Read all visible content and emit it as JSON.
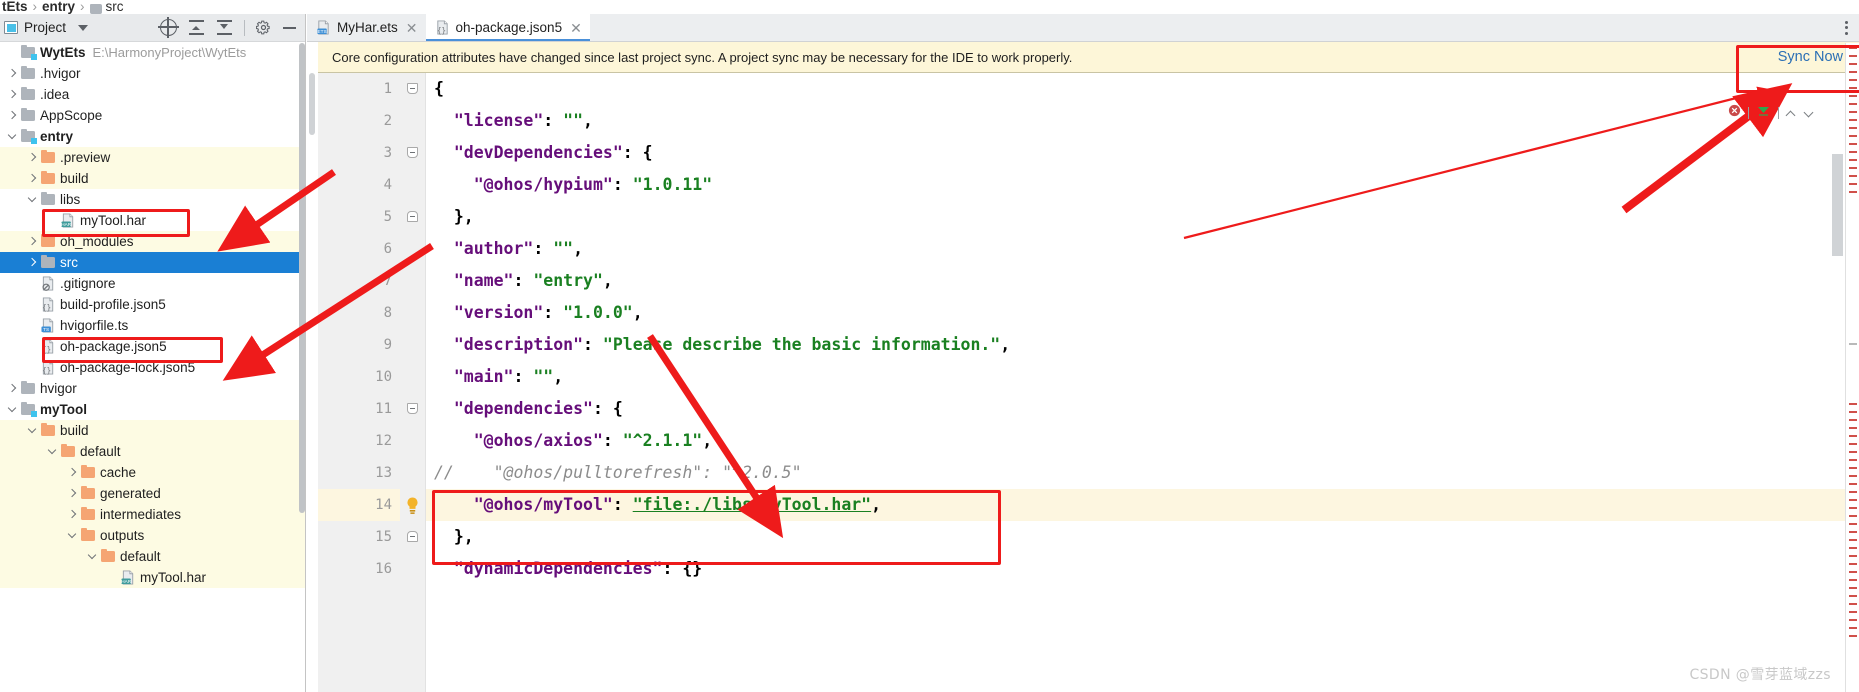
{
  "breadcrumb": {
    "items": [
      "tEts",
      "entry",
      "src"
    ]
  },
  "panel": {
    "title": "Project",
    "icons": [
      "project-icon",
      "chevron-down-icon",
      "locate-icon",
      "expand-all-icon",
      "collapse-all-icon",
      "gear-icon",
      "minimize-icon"
    ],
    "tree": [
      {
        "label": "WytEts",
        "path": "E:\\HarmonyProject\\WytEts",
        "indent": 0,
        "arrow": "none",
        "icon": "folder-module",
        "bold": true
      },
      {
        "label": ".hvigor",
        "path": "",
        "indent": 0,
        "arrow": "right",
        "icon": "folder-grey",
        "bold": false
      },
      {
        "label": ".idea",
        "path": "",
        "indent": 0,
        "arrow": "right",
        "icon": "folder-grey",
        "bold": false
      },
      {
        "label": "AppScope",
        "path": "",
        "indent": 0,
        "arrow": "right",
        "icon": "folder-grey",
        "bold": false
      },
      {
        "label": "entry",
        "path": "",
        "indent": 0,
        "arrow": "down",
        "icon": "folder-module",
        "bold": true
      },
      {
        "label": ".preview",
        "path": "",
        "indent": 1,
        "arrow": "right",
        "icon": "folder-orange",
        "bold": false,
        "highlight": "yellow"
      },
      {
        "label": "build",
        "path": "",
        "indent": 1,
        "arrow": "right",
        "icon": "folder-orange",
        "bold": false,
        "highlight": "yellow"
      },
      {
        "label": "libs",
        "path": "",
        "indent": 1,
        "arrow": "down",
        "icon": "folder-grey",
        "bold": false
      },
      {
        "label": "myTool.har",
        "path": "",
        "indent": 2,
        "arrow": "none",
        "icon": "file-har",
        "bold": false
      },
      {
        "label": "oh_modules",
        "path": "",
        "indent": 1,
        "arrow": "right",
        "icon": "folder-orange",
        "bold": false,
        "highlight": "yellow"
      },
      {
        "label": "src",
        "path": "",
        "indent": 1,
        "arrow": "right",
        "icon": "folder-grey",
        "bold": false,
        "selected": true
      },
      {
        "label": ".gitignore",
        "path": "",
        "indent": 1,
        "arrow": "none",
        "icon": "file-git",
        "bold": false
      },
      {
        "label": "build-profile.json5",
        "path": "",
        "indent": 1,
        "arrow": "none",
        "icon": "file-json",
        "bold": false
      },
      {
        "label": "hvigorfile.ts",
        "path": "",
        "indent": 1,
        "arrow": "none",
        "icon": "file-ts",
        "bold": false
      },
      {
        "label": "oh-package.json5",
        "path": "",
        "indent": 1,
        "arrow": "none",
        "icon": "file-json",
        "bold": false
      },
      {
        "label": "oh-package-lock.json5",
        "path": "",
        "indent": 1,
        "arrow": "none",
        "icon": "file-json",
        "bold": false
      },
      {
        "label": "hvigor",
        "path": "",
        "indent": 0,
        "arrow": "right",
        "icon": "folder-grey",
        "bold": false
      },
      {
        "label": "myTool",
        "path": "",
        "indent": 0,
        "arrow": "down",
        "icon": "folder-module",
        "bold": true
      },
      {
        "label": "build",
        "path": "",
        "indent": 1,
        "arrow": "down",
        "icon": "folder-orange",
        "bold": false,
        "highlight": "yellow"
      },
      {
        "label": "default",
        "path": "",
        "indent": 2,
        "arrow": "down",
        "icon": "folder-orange",
        "bold": false,
        "highlight": "yellow"
      },
      {
        "label": "cache",
        "path": "",
        "indent": 3,
        "arrow": "right",
        "icon": "folder-orange",
        "bold": false,
        "highlight": "yellow"
      },
      {
        "label": "generated",
        "path": "",
        "indent": 3,
        "arrow": "right",
        "icon": "folder-orange",
        "bold": false,
        "highlight": "yellow"
      },
      {
        "label": "intermediates",
        "path": "",
        "indent": 3,
        "arrow": "right",
        "icon": "folder-orange",
        "bold": false,
        "highlight": "yellow"
      },
      {
        "label": "outputs",
        "path": "",
        "indent": 3,
        "arrow": "down",
        "icon": "folder-orange",
        "bold": false,
        "highlight": "yellow"
      },
      {
        "label": "default",
        "path": "",
        "indent": 4,
        "arrow": "down",
        "icon": "folder-orange",
        "bold": false,
        "highlight": "yellow"
      },
      {
        "label": "myTool.har",
        "path": "",
        "indent": 5,
        "arrow": "none",
        "icon": "file-har",
        "bold": false,
        "highlight": "yellow"
      }
    ]
  },
  "editor": {
    "tabs": [
      {
        "label": "MyHar.ets",
        "icon": "ets-file-icon",
        "active": false
      },
      {
        "label": "oh-package.json5",
        "icon": "json-file-icon",
        "active": true
      }
    ],
    "tab_overflow_icon": "more-vertical-icon",
    "notification": {
      "text": "Core configuration attributes have changed since last project sync. A project sync may be necessary for the IDE to work properly.",
      "action": "Sync Now"
    },
    "inspection_widget": {
      "error_count_icon": "error-marker-icon",
      "ok_icon": "inspection-ok-icon",
      "prev_icon": "chevron-up-icon",
      "next_icon": "chevron-down-icon"
    },
    "lines": [
      {
        "n": "1",
        "fold": "open-start",
        "segments": [
          {
            "t": "{",
            "c": "punc"
          }
        ]
      },
      {
        "n": "2",
        "fold": "",
        "segments": [
          {
            "t": "  ",
            "c": "punc"
          },
          {
            "t": "\"license\"",
            "c": "key"
          },
          {
            "t": ": ",
            "c": "punc"
          },
          {
            "t": "\"\"",
            "c": "str"
          },
          {
            "t": ",",
            "c": "punc"
          }
        ]
      },
      {
        "n": "3",
        "fold": "open",
        "segments": [
          {
            "t": "  ",
            "c": "punc"
          },
          {
            "t": "\"devDependencies\"",
            "c": "key"
          },
          {
            "t": ": {",
            "c": "punc"
          }
        ]
      },
      {
        "n": "4",
        "fold": "",
        "segments": [
          {
            "t": "    ",
            "c": "punc"
          },
          {
            "t": "\"@ohos/hypium\"",
            "c": "key"
          },
          {
            "t": ": ",
            "c": "punc"
          },
          {
            "t": "\"1.0.11\"",
            "c": "str"
          }
        ]
      },
      {
        "n": "5",
        "fold": "end",
        "segments": [
          {
            "t": "  },",
            "c": "punc"
          }
        ]
      },
      {
        "n": "6",
        "fold": "",
        "segments": [
          {
            "t": "  ",
            "c": "punc"
          },
          {
            "t": "\"author\"",
            "c": "key"
          },
          {
            "t": ": ",
            "c": "punc"
          },
          {
            "t": "\"\"",
            "c": "str"
          },
          {
            "t": ",",
            "c": "punc"
          }
        ]
      },
      {
        "n": "7",
        "fold": "",
        "segments": [
          {
            "t": "  ",
            "c": "punc"
          },
          {
            "t": "\"name\"",
            "c": "key"
          },
          {
            "t": ": ",
            "c": "punc"
          },
          {
            "t": "\"entry\"",
            "c": "str"
          },
          {
            "t": ",",
            "c": "punc"
          }
        ]
      },
      {
        "n": "8",
        "fold": "",
        "segments": [
          {
            "t": "  ",
            "c": "punc"
          },
          {
            "t": "\"version\"",
            "c": "key"
          },
          {
            "t": ": ",
            "c": "punc"
          },
          {
            "t": "\"1.0.0\"",
            "c": "str"
          },
          {
            "t": ",",
            "c": "punc"
          }
        ]
      },
      {
        "n": "9",
        "fold": "",
        "segments": [
          {
            "t": "  ",
            "c": "punc"
          },
          {
            "t": "\"description\"",
            "c": "key"
          },
          {
            "t": ": ",
            "c": "punc"
          },
          {
            "t": "\"Please describe the basic information.\"",
            "c": "str"
          },
          {
            "t": ",",
            "c": "punc"
          }
        ]
      },
      {
        "n": "10",
        "fold": "",
        "segments": [
          {
            "t": "  ",
            "c": "punc"
          },
          {
            "t": "\"main\"",
            "c": "key"
          },
          {
            "t": ": ",
            "c": "punc"
          },
          {
            "t": "\"\"",
            "c": "str"
          },
          {
            "t": ",",
            "c": "punc"
          }
        ]
      },
      {
        "n": "11",
        "fold": "open",
        "segments": [
          {
            "t": "  ",
            "c": "punc"
          },
          {
            "t": "\"dependencies\"",
            "c": "key"
          },
          {
            "t": ": {",
            "c": "punc"
          }
        ]
      },
      {
        "n": "12",
        "fold": "",
        "segments": [
          {
            "t": "    ",
            "c": "punc"
          },
          {
            "t": "\"@ohos/axios\"",
            "c": "key"
          },
          {
            "t": ": ",
            "c": "punc"
          },
          {
            "t": "\"^2.1.1\"",
            "c": "str"
          },
          {
            "t": ",",
            "c": "punc"
          }
        ]
      },
      {
        "n": "13",
        "fold": "",
        "segments": [
          {
            "t": "//    \"@ohos/pulltorefresh\": \"^2.0.5\"",
            "c": "com"
          }
        ]
      },
      {
        "n": "14",
        "fold": "bulb",
        "highlight": true,
        "segments": [
          {
            "t": "    ",
            "c": "punc"
          },
          {
            "t": "\"@ohos/myTool\"",
            "c": "key"
          },
          {
            "t": ": ",
            "c": "punc"
          },
          {
            "t": "\"file:./libs/myTool.har\"",
            "c": "link"
          },
          {
            "t": ",",
            "c": "punc"
          }
        ]
      },
      {
        "n": "15",
        "fold": "end",
        "segments": [
          {
            "t": "  },",
            "c": "punc"
          }
        ]
      },
      {
        "n": "16",
        "fold": "",
        "segments": [
          {
            "t": "  ",
            "c": "punc"
          },
          {
            "t": "\"dynamicDependencies\"",
            "c": "key"
          },
          {
            "t": ": {}",
            "c": "punc"
          }
        ]
      }
    ]
  },
  "annotations": {
    "boxes": [
      {
        "name": "mytool-har-highlight-box"
      },
      {
        "name": "oh-package-json5-highlight-box"
      },
      {
        "name": "sync-now-highlight-box"
      },
      {
        "name": "mytool-dependency-highlight-box"
      }
    ],
    "arrows": [
      {
        "name": "arrow-to-mytool-har"
      },
      {
        "name": "arrow-to-oh-package-json5"
      },
      {
        "name": "arrow-to-dependency-line"
      },
      {
        "name": "arrow-to-inspection-widget"
      }
    ]
  },
  "watermark": {
    "text": "CSDN @雪芽蓝域zzs"
  }
}
